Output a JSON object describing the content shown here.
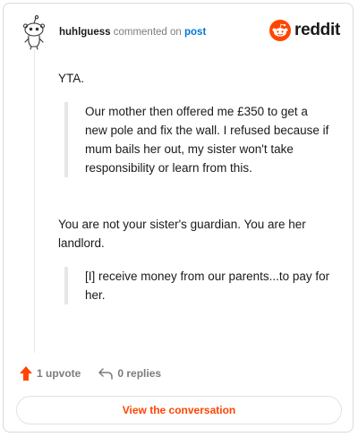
{
  "header": {
    "username": "huhlguess",
    "commented_text": "commented on",
    "post_link": "post",
    "brand": "reddit"
  },
  "comment": {
    "p1": "YTA.",
    "quote1": "Our mother then offered me £350 to get a new pole and fix the wall. I refused because if mum bails her out, my sister won't take responsibility or learn from this.",
    "p2": "You are not your sister's guardian. You are her landlord.",
    "quote2": "[I] receive money from our parents...to pay for her."
  },
  "footer": {
    "upvotes": "1 upvote",
    "replies": "0 replies"
  },
  "cta": {
    "label": "View the conversation"
  },
  "colors": {
    "accent": "#ff4500",
    "link": "#0079d3",
    "muted": "#7c7c7c"
  },
  "icons": [
    "snoo-avatar-icon",
    "reddit-logo-icon",
    "upvote-arrow-icon",
    "reply-icon"
  ]
}
